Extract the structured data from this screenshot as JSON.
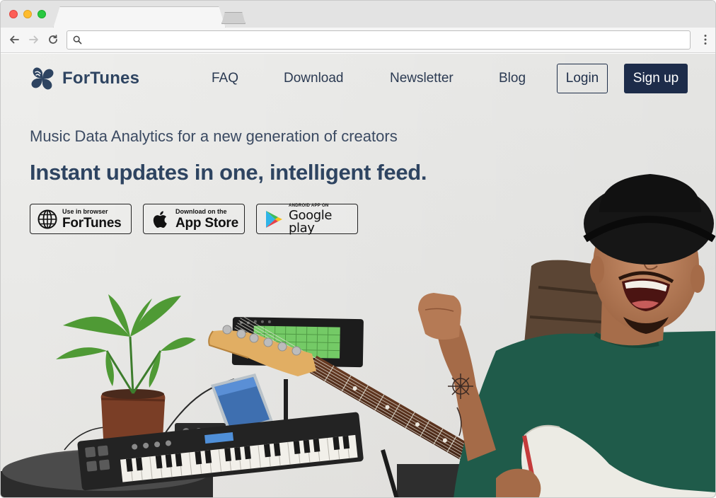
{
  "browser": {
    "address_value": "",
    "address_placeholder": ""
  },
  "site": {
    "logo_text": "ForTunes",
    "nav": [
      {
        "label": "FAQ"
      },
      {
        "label": "Download"
      },
      {
        "label": "Newsletter"
      },
      {
        "label": "Blog"
      }
    ],
    "login_label": "Login",
    "signup_label": "Sign up"
  },
  "hero": {
    "subtitle": "Music Data Analytics for a new generation of creators",
    "title": "Instant updates in one, intelligent feed."
  },
  "badges": {
    "web": {
      "small": "Use in browser",
      "big": "ForTunes"
    },
    "appstore": {
      "small": "Download on the",
      "big": "App Store"
    },
    "googleplay": {
      "small": "ANDROID APP ON",
      "big": "Google play"
    }
  },
  "colors": {
    "brand": "#2e4461",
    "signup_bg": "#1d2c4a",
    "shirt": "#1f5b4a",
    "hat": "#161616"
  }
}
